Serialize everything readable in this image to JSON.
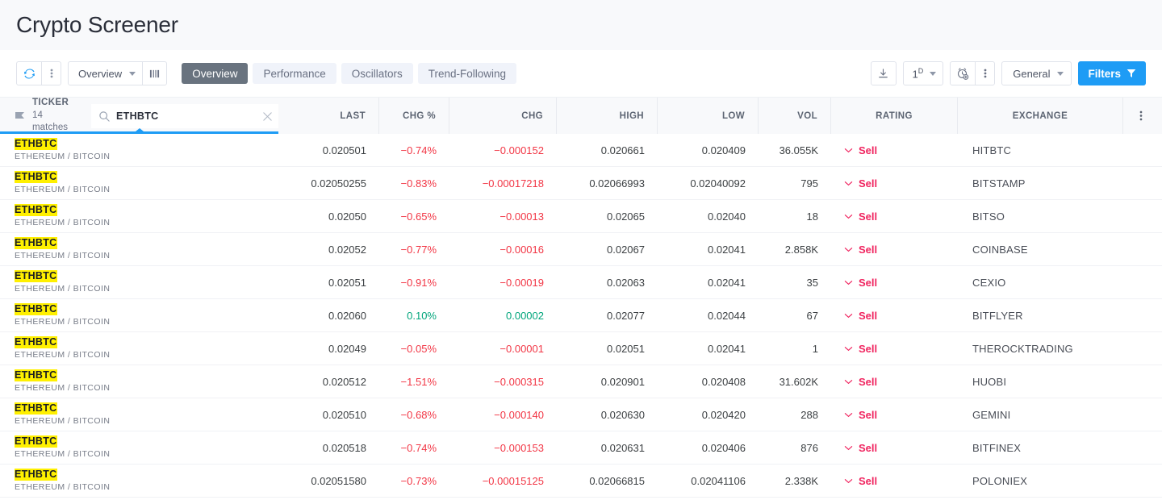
{
  "header": {
    "title": "Crypto Screener"
  },
  "toolbar": {
    "refresh_icon": "refresh-icon",
    "more_icon": "vertical-dots-icon",
    "preset_label": "Overview",
    "columns_icon": "columns-icon",
    "tabs": [
      {
        "label": "Overview",
        "active": true
      },
      {
        "label": "Performance",
        "active": false
      },
      {
        "label": "Oscillators",
        "active": false
      },
      {
        "label": "Trend-Following",
        "active": false
      }
    ],
    "download_icon": "download-icon",
    "interval_label": "1",
    "interval_sup": "D",
    "alarm_icon": "alarm-clock-plus-icon",
    "alarm_more_icon": "vertical-dots-icon",
    "general_label": "General",
    "filters_label": "Filters",
    "filters_icon": "funnel-icon",
    "accent_color": "#1e9cf5",
    "active_tab_color": "#69737f"
  },
  "table": {
    "ticker_header": {
      "title": "TICKER",
      "matches": "14 matches",
      "flag_icon": "flag-icon"
    },
    "search": {
      "value": "ETHBTC",
      "placeholder": "",
      "search_icon": "search-icon",
      "clear_icon": "close-icon"
    },
    "row_menu_icon": "vertical-dots-icon",
    "columns": [
      {
        "key": "last",
        "label": "LAST"
      },
      {
        "key": "chg_pct",
        "label": "CHG %"
      },
      {
        "key": "chg",
        "label": "CHG"
      },
      {
        "key": "high",
        "label": "HIGH"
      },
      {
        "key": "low",
        "label": "LOW"
      },
      {
        "key": "vol",
        "label": "VOL"
      },
      {
        "key": "rating",
        "label": "RATING"
      },
      {
        "key": "exchange",
        "label": "EXCHANGE"
      }
    ],
    "colors": {
      "negative": "#f23645",
      "positive": "#00a57b",
      "sell": "#f0245f",
      "highlight": "#fff000"
    },
    "rows": [
      {
        "symbol": "ETHBTC",
        "desc": "ETHEREUM / BITCOIN",
        "last": "0.020501",
        "chg_pct": "−0.74%",
        "chg": "−0.000152",
        "high": "0.020661",
        "low": "0.020409",
        "vol": "36.055K",
        "rating": "Sell",
        "exchange": "HITBTC",
        "dir": "neg"
      },
      {
        "symbol": "ETHBTC",
        "desc": "ETHEREUM / BITCOIN",
        "last": "0.02050255",
        "chg_pct": "−0.83%",
        "chg": "−0.00017218",
        "high": "0.02066993",
        "low": "0.02040092",
        "vol": "795",
        "rating": "Sell",
        "exchange": "BITSTAMP",
        "dir": "neg"
      },
      {
        "symbol": "ETHBTC",
        "desc": "ETHEREUM / BITCOIN",
        "last": "0.02050",
        "chg_pct": "−0.65%",
        "chg": "−0.00013",
        "high": "0.02065",
        "low": "0.02040",
        "vol": "18",
        "rating": "Sell",
        "exchange": "BITSO",
        "dir": "neg"
      },
      {
        "symbol": "ETHBTC",
        "desc": "ETHEREUM / BITCOIN",
        "last": "0.02052",
        "chg_pct": "−0.77%",
        "chg": "−0.00016",
        "high": "0.02067",
        "low": "0.02041",
        "vol": "2.858K",
        "rating": "Sell",
        "exchange": "COINBASE",
        "dir": "neg"
      },
      {
        "symbol": "ETHBTC",
        "desc": "ETHEREUM / BITCOIN",
        "last": "0.02051",
        "chg_pct": "−0.91%",
        "chg": "−0.00019",
        "high": "0.02063",
        "low": "0.02041",
        "vol": "35",
        "rating": "Sell",
        "exchange": "CEXIO",
        "dir": "neg"
      },
      {
        "symbol": "ETHBTC",
        "desc": "ETHEREUM / BITCOIN",
        "last": "0.02060",
        "chg_pct": "0.10%",
        "chg": "0.00002",
        "high": "0.02077",
        "low": "0.02044",
        "vol": "67",
        "rating": "Sell",
        "exchange": "BITFLYER",
        "dir": "pos"
      },
      {
        "symbol": "ETHBTC",
        "desc": "ETHEREUM / BITCOIN",
        "last": "0.02049",
        "chg_pct": "−0.05%",
        "chg": "−0.00001",
        "high": "0.02051",
        "low": "0.02041",
        "vol": "1",
        "rating": "Sell",
        "exchange": "THEROCKTRADING",
        "dir": "neg"
      },
      {
        "symbol": "ETHBTC",
        "desc": "ETHEREUM / BITCOIN",
        "last": "0.020512",
        "chg_pct": "−1.51%",
        "chg": "−0.000315",
        "high": "0.020901",
        "low": "0.020408",
        "vol": "31.602K",
        "rating": "Sell",
        "exchange": "HUOBI",
        "dir": "neg"
      },
      {
        "symbol": "ETHBTC",
        "desc": "ETHEREUM / BITCOIN",
        "last": "0.020510",
        "chg_pct": "−0.68%",
        "chg": "−0.000140",
        "high": "0.020630",
        "low": "0.020420",
        "vol": "288",
        "rating": "Sell",
        "exchange": "GEMINI",
        "dir": "neg"
      },
      {
        "symbol": "ETHBTC",
        "desc": "ETHEREUM / BITCOIN",
        "last": "0.020518",
        "chg_pct": "−0.74%",
        "chg": "−0.000153",
        "high": "0.020631",
        "low": "0.020406",
        "vol": "876",
        "rating": "Sell",
        "exchange": "BITFINEX",
        "dir": "neg"
      },
      {
        "symbol": "ETHBTC",
        "desc": "ETHEREUM / BITCOIN",
        "last": "0.02051580",
        "chg_pct": "−0.73%",
        "chg": "−0.00015125",
        "high": "0.02066815",
        "low": "0.02041106",
        "vol": "2.338K",
        "rating": "Sell",
        "exchange": "POLONIEX",
        "dir": "neg"
      }
    ]
  }
}
